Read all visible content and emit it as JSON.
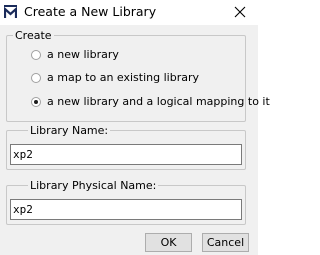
{
  "window": {
    "title": "Create a New Library",
    "icon": "matlab-m-icon"
  },
  "create_group": {
    "legend": "Create",
    "options": [
      {
        "label": "a new library",
        "selected": false
      },
      {
        "label": "a map to an existing library",
        "selected": false
      },
      {
        "label": "a new library and a logical mapping to it",
        "selected": true
      }
    ]
  },
  "library_name": {
    "label": "Library Name:",
    "value": "xp2"
  },
  "library_physical_name": {
    "label": "Library Physical Name:",
    "value": "xp2"
  },
  "buttons": {
    "ok": "OK",
    "cancel": "Cancel"
  }
}
